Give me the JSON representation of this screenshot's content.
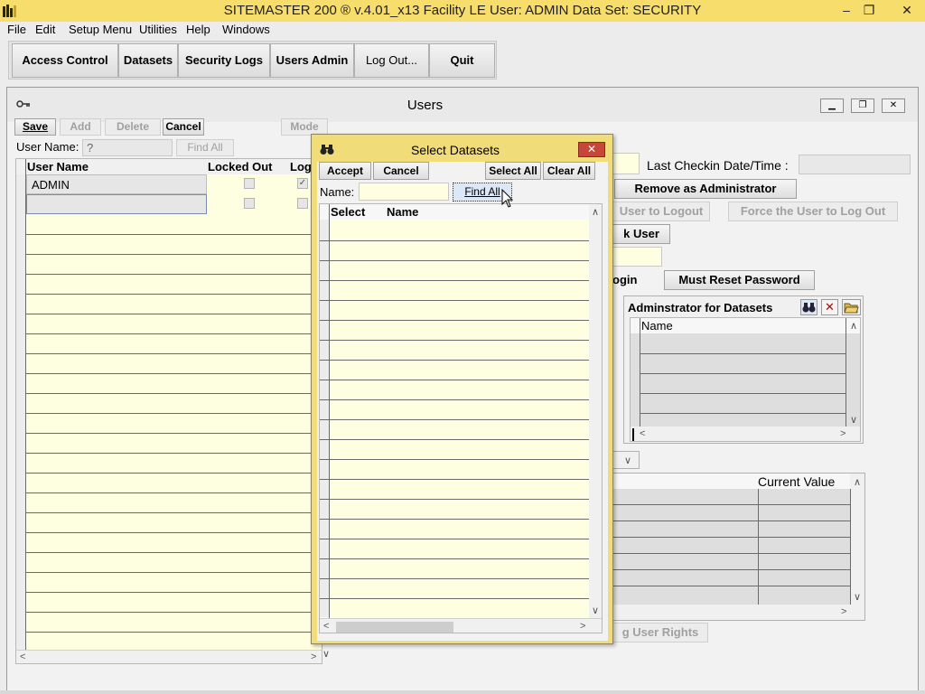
{
  "titlebar": {
    "title": "SITEMASTER 200 ® v.4.01_x13 Facility LE    User: ADMIN    Data Set: SECURITY",
    "minimize": "–",
    "restore": "❐",
    "close": "✕"
  },
  "menu": [
    "File",
    "Edit",
    "Setup Menu",
    "Utilities",
    "Help",
    "Windows"
  ],
  "toolbar": [
    "Access Control",
    "Datasets",
    "Security Logs",
    "Users Admin",
    "Log Out...",
    "Quit"
  ],
  "users_window": {
    "title": "Users",
    "buttons": {
      "save": "Save",
      "add": "Add",
      "delete": "Delete",
      "cancel": "Cancel",
      "mode": "Mode"
    },
    "user_name_label": "User Name:",
    "user_name_value": "?",
    "find_all": "Find All",
    "grid_headers": {
      "user_name": "User Name",
      "locked_out": "Locked Out",
      "log": "Log"
    },
    "rows": [
      {
        "user_name": "ADMIN",
        "locked_out": false,
        "log": true
      }
    ],
    "last_checkin_label": "Last Checkin Date/Time :",
    "remove_admin": "Remove as Administrator",
    "user_to_logout": "User to Logout",
    "force_logout": "Force the User to Log Out",
    "unlock_user": "k User",
    "login_label": "ogin",
    "must_reset": "Must Reset Password",
    "admin_panel": {
      "title": "Adminstrator for Datasets",
      "col_name": "Name"
    },
    "current_value_header": "Current Value",
    "user_rights": "g User Rights"
  },
  "dialog": {
    "title": "Select Datasets",
    "accept": "Accept",
    "cancel": "Cancel",
    "select_all": "Select All",
    "clear_all": "Clear All",
    "name_label": "Name:",
    "name_value": "",
    "find_all": "Find All",
    "col_select": "Select",
    "col_name": "Name"
  }
}
